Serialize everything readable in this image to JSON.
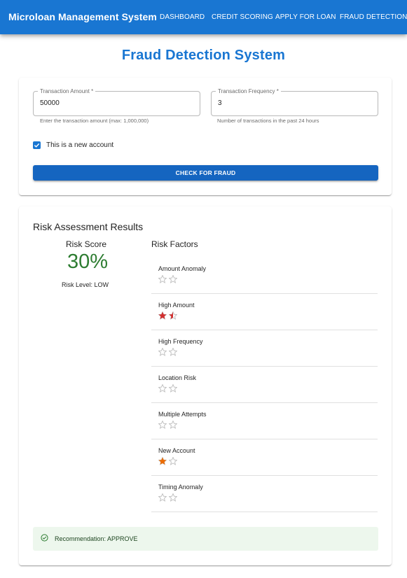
{
  "app": {
    "brand": "Microloan Management System",
    "nav": [
      "DASHBOARD",
      "CREDIT SCORING",
      "APPLY FOR LOAN",
      "FRAUD DETECTION"
    ]
  },
  "page_title": "Fraud Detection System",
  "form": {
    "amount_label": "Transaction Amount *",
    "amount_value": "50000",
    "amount_helper": "Enter the transaction amount (max: 1,000,000)",
    "frequency_label": "Transaction Frequency *",
    "frequency_value": "3",
    "frequency_helper": "Number of transactions in the past 24 hours",
    "new_account_label": "This is a new account",
    "new_account_checked": true,
    "submit_label": "CHECK FOR FRAUD"
  },
  "results": {
    "title": "Risk Assessment Results",
    "score_heading": "Risk Score",
    "score_value": "30%",
    "risk_level": "Risk Level: LOW",
    "factors_heading": "Risk Factors",
    "factors": [
      {
        "label": "Amount Anomaly",
        "rating": 0,
        "max": 2,
        "color": "#d32f2f"
      },
      {
        "label": "High Amount",
        "rating": 1.5,
        "max": 2,
        "color": "#d32f2f"
      },
      {
        "label": "High Frequency",
        "rating": 0,
        "max": 2,
        "color": "#d32f2f"
      },
      {
        "label": "Location Risk",
        "rating": 0,
        "max": 2,
        "color": "#d32f2f"
      },
      {
        "label": "Multiple Attempts",
        "rating": 0,
        "max": 2,
        "color": "#d32f2f"
      },
      {
        "label": "New Account",
        "rating": 1,
        "max": 2,
        "color": "#ed6c02"
      },
      {
        "label": "Timing Anomaly",
        "rating": 0,
        "max": 2,
        "color": "#d32f2f"
      }
    ],
    "recommendation": "Recommendation: APPROVE"
  },
  "colors": {
    "primary": "#1976d2",
    "score": "#2e7d32",
    "success_bg": "#edf7ed",
    "star_empty": "#bdbdbd"
  }
}
